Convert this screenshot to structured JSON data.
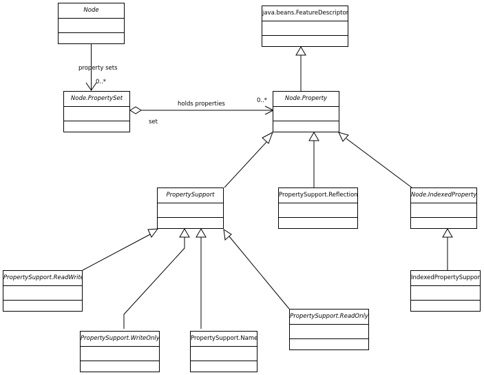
{
  "diagram": {
    "type": "UML class diagram",
    "classes": {
      "node": {
        "name": "Node",
        "abstract": true
      },
      "feature_descriptor": {
        "name": "java.beans.FeatureDescriptor",
        "abstract": false
      },
      "property_set": {
        "name": "Node.PropertySet",
        "abstract": true
      },
      "property": {
        "name": "Node.Property",
        "abstract": true
      },
      "property_support": {
        "name": "PropertySupport",
        "abstract": true
      },
      "reflection": {
        "name": "PropertySupport.Reflection",
        "abstract": false
      },
      "indexed_property": {
        "name": "Node.IndexedProperty",
        "abstract": true
      },
      "read_write": {
        "name": "PropertySupport.ReadWrite",
        "abstract": true
      },
      "indexed_property_support": {
        "name": "IndexedPropertySupport",
        "abstract": false
      },
      "write_only": {
        "name": "PropertySupport.WriteOnly",
        "abstract": true
      },
      "name_cls": {
        "name": "PropertySupport.Name",
        "abstract": false
      },
      "read_only": {
        "name": "PropertySupport.ReadOnly",
        "abstract": true
      }
    },
    "associations": {
      "property_sets": {
        "label": "property sets",
        "multiplicity": "0..*",
        "from": "Node",
        "to": "Node.PropertySet"
      },
      "holds_properties": {
        "label": "holds properties",
        "multiplicity": "0..*",
        "role": "set",
        "from": "Node.PropertySet",
        "to": "Node.Property",
        "kind": "aggregation"
      }
    },
    "generalizations": [
      {
        "child": "Node.Property",
        "parent": "java.beans.FeatureDescriptor"
      },
      {
        "child": "PropertySupport",
        "parent": "Node.Property"
      },
      {
        "child": "PropertySupport.Reflection",
        "parent": "Node.Property"
      },
      {
        "child": "Node.IndexedProperty",
        "parent": "Node.Property"
      },
      {
        "child": "PropertySupport.ReadWrite",
        "parent": "PropertySupport"
      },
      {
        "child": "PropertySupport.WriteOnly",
        "parent": "PropertySupport"
      },
      {
        "child": "PropertySupport.Name",
        "parent": "PropertySupport"
      },
      {
        "child": "PropertySupport.ReadOnly",
        "parent": "PropertySupport"
      },
      {
        "child": "IndexedPropertySupport",
        "parent": "Node.IndexedProperty"
      }
    ]
  }
}
